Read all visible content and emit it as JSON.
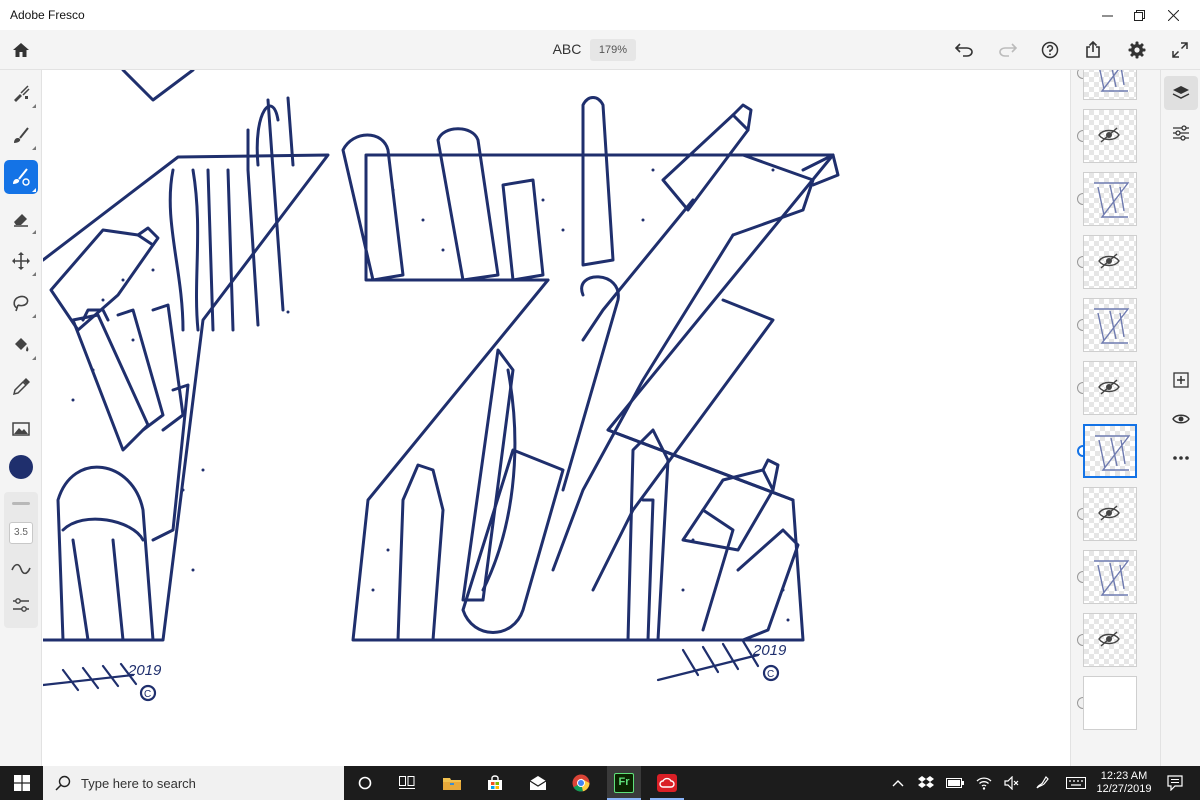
{
  "window": {
    "title": "Adobe Fresco"
  },
  "toolbar": {
    "document_title": "ABC",
    "zoom": "179%"
  },
  "brush": {
    "size": "3.5",
    "color": "#1f2f6d"
  },
  "colors": {
    "accent": "#1473e6",
    "ink": "#1f2f6d",
    "taskbar": "#1c1c1c"
  },
  "left_tools": [
    {
      "name": "pixel-brush-icon"
    },
    {
      "name": "live-brush-icon"
    },
    {
      "name": "vector-brush-icon",
      "active": true
    },
    {
      "name": "eraser-icon"
    },
    {
      "name": "move-icon"
    },
    {
      "name": "lasso-icon"
    },
    {
      "name": "fill-icon"
    },
    {
      "name": "eyedropper-icon"
    },
    {
      "name": "image-icon"
    }
  ],
  "layers": [
    {
      "visible": true
    },
    {
      "visible": false
    },
    {
      "visible": true
    },
    {
      "visible": false
    },
    {
      "visible": true
    },
    {
      "visible": false
    },
    {
      "visible": true,
      "selected": true
    },
    {
      "visible": false
    },
    {
      "visible": true
    },
    {
      "visible": false
    },
    {
      "visible": true,
      "image": true
    }
  ],
  "artwork": {
    "signature_year": "2019",
    "signature_copyright": "C"
  },
  "taskbar": {
    "search_placeholder": "Type here to search",
    "apps": [
      "task-view-icon",
      "file-explorer-icon",
      "store-icon",
      "mail-icon",
      "chrome-icon",
      "fresco-app-icon",
      "creative-cloud-icon"
    ],
    "fresco_label": "Fr",
    "time": "12:23 AM",
    "date": "12/27/2019"
  }
}
